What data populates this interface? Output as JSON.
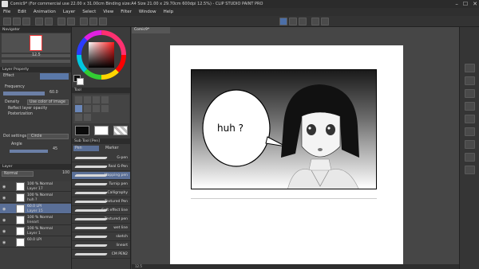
{
  "window": {
    "title": "Comic9* (For commercial use 22.00 x 31.00cm Binding size:A4 Size 21.00 x 29.70cm 600dpi 12.5%) - CLIP STUDIO PAINT PRO",
    "minimize": "–",
    "maximize": "☐",
    "close": "✕"
  },
  "menu": [
    "File",
    "Edit",
    "Animation",
    "Layer",
    "Select",
    "View",
    "Filter",
    "Window",
    "Help"
  ],
  "navigator": {
    "title": "Navigator",
    "zoom": "12.5",
    "rotation": "0.0"
  },
  "layer_property": {
    "title": "Layer Property",
    "effect_label": "Effect",
    "frequency_label": "Frequency",
    "frequency_value": "60.0",
    "density_label": "Density",
    "density_value": "Use color of image",
    "reflect_opacity": "Reflect layer opacity",
    "posterization": "Posterization",
    "dot_settings_label": "Dot settings",
    "dot_settings_value": "Circle",
    "angle_label": "Angle",
    "angle_value": "45"
  },
  "tool_options": {
    "tab1": "Tool",
    "sub_tool": "Sub Tool [Pen]",
    "pen_tab": "Pen",
    "marker_tab": "Marker",
    "brushes": [
      "G-pen",
      "Real G-Pen",
      "Mapping pen",
      "Turnip pen",
      "Calligraphy",
      "Textured Pen",
      "Soft effect line",
      "Textured pen",
      "wet line",
      "sketch",
      "lineart",
      "CM PEN2"
    ]
  },
  "layers": {
    "title": "Layer",
    "blend_mode": "Normal",
    "opacity": "100",
    "items": [
      {
        "pct": "100 % Normal",
        "name": "Layer 17"
      },
      {
        "pct": "100 % Normal",
        "name": "huh ?"
      },
      {
        "pct": "60.0 LPI",
        "name": "Layer 15"
      },
      {
        "pct": "100 % Normal",
        "name": "lineart"
      },
      {
        "pct": "100 % Normal",
        "name": "Layer 1"
      },
      {
        "pct": "60.0 LPI",
        "name": ""
      }
    ]
  },
  "canvas": {
    "tab_label": "Comic9*",
    "speech_text": "huh ?",
    "zoom_status": "12.5"
  },
  "colors": {
    "accent": "#4c6fa8",
    "panel": "#3b3b3b"
  }
}
